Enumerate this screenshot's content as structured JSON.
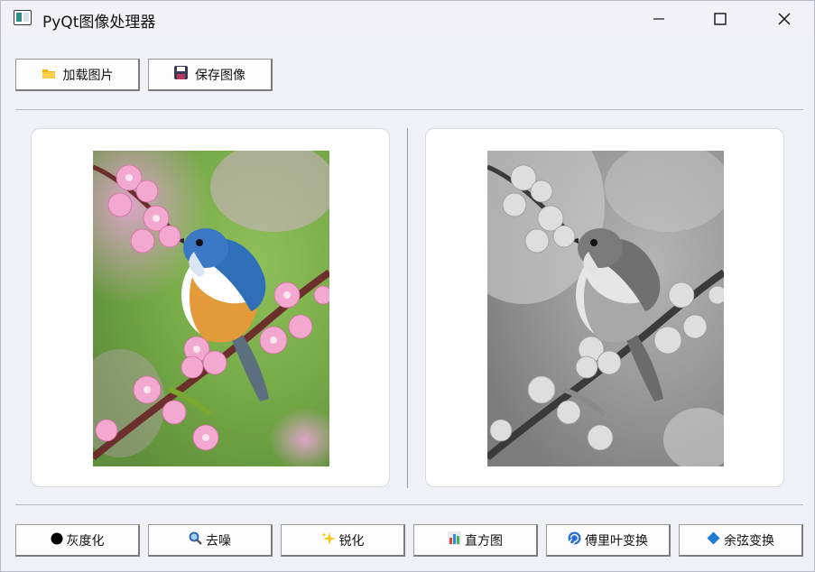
{
  "window": {
    "title": "PyQt图像处理器"
  },
  "toolbar": {
    "load_label": "加载图片",
    "save_label": "保存图像"
  },
  "images": {
    "original": {
      "description": "color-image",
      "subject": "bird-on-cherry-blossom"
    },
    "processed": {
      "description": "grayscale-image",
      "subject": "bird-on-cherry-blossom"
    }
  },
  "actions": [
    {
      "label": "灰度化",
      "icon": "black-circle-icon"
    },
    {
      "label": "去噪",
      "icon": "magnifier-icon"
    },
    {
      "label": "锐化",
      "icon": "sparkles-icon"
    },
    {
      "label": "直方图",
      "icon": "bar-chart-icon"
    },
    {
      "label": "傅里叶变换",
      "icon": "cyclone-icon"
    },
    {
      "label": "余弦变换",
      "icon": "blue-diamond-icon"
    }
  ],
  "colors": {
    "window_bg": "#eff1f7",
    "panel_bg": "#ffffff",
    "accent": "#2f8f88"
  }
}
